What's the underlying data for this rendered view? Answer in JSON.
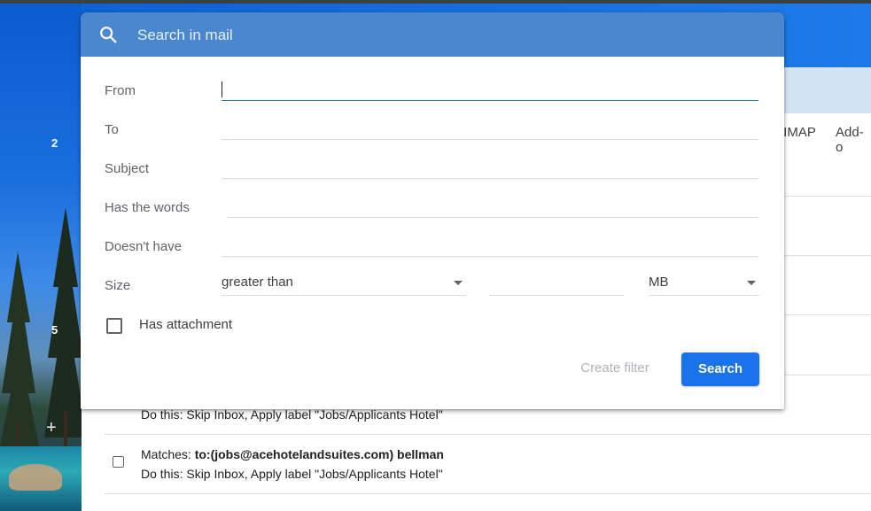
{
  "search": {
    "placeholder": "Search in mail"
  },
  "form": {
    "from_label": "From",
    "from_value": "",
    "to_label": "To",
    "subject_label": "Subject",
    "has_words_label": "Has the words",
    "doesnt_have_label": "Doesn't have",
    "size_label": "Size",
    "size_operator": "greater than",
    "size_value": "",
    "size_unit": "MB",
    "has_attachment_label": "Has attachment",
    "has_attachment_checked": false,
    "create_filter_label": "Create filter",
    "search_label": "Search"
  },
  "background": {
    "settings_tabs": [
      "/IMAP",
      "Add-o"
    ],
    "left_numbers": [
      "2",
      "5"
    ],
    "filters": [
      {
        "do_this": "Do this: Skip Inbox, Apply label \"Jobs/Applicants Hotel\""
      },
      {
        "matches_prefix": "Matches: ",
        "matches_bold": "to:(jobs@acehotelandsuites.com) bellman",
        "do_this": "Do this: Skip Inbox, Apply label \"Jobs/Applicants Hotel\""
      }
    ]
  },
  "colors": {
    "dialog_header": "#4b87cd",
    "primary_button": "#1a73e8",
    "focus_underline": "#1a73e8"
  }
}
